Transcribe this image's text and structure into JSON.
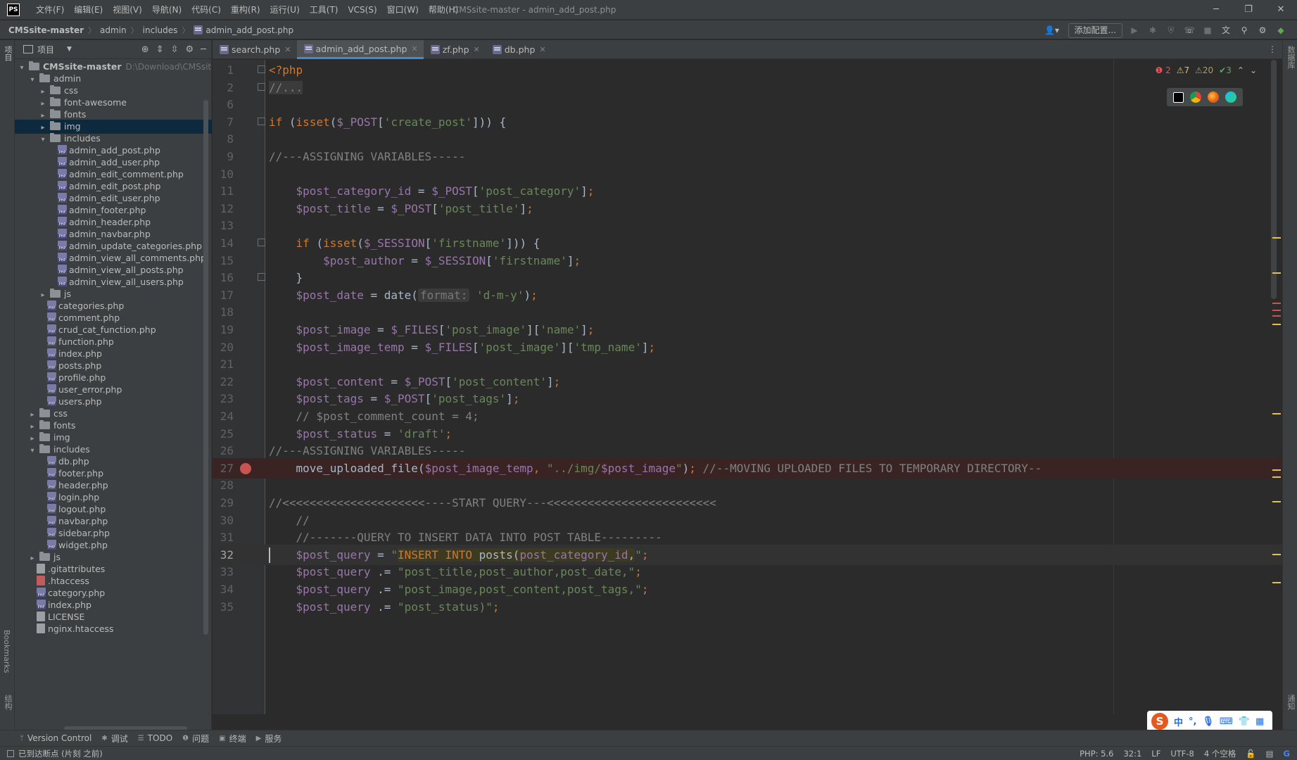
{
  "menu": [
    "文件(F)",
    "编辑(E)",
    "视图(V)",
    "导航(N)",
    "代码(C)",
    "重构(R)",
    "运行(U)",
    "工具(T)",
    "VCS(S)",
    "窗口(W)",
    "帮助(H)"
  ],
  "window_title": "CMSsite-master - admin_add_post.php",
  "app_logo": "PS",
  "breadcrumb": [
    "CMSsite-master",
    "admin",
    "includes",
    "admin_add_post.php"
  ],
  "nav_right": {
    "add_config": "添加配置..."
  },
  "left_strip": {
    "project": "项目",
    "bookmarks": "Bookmarks",
    "structure": "结构"
  },
  "right_strip": {
    "database": "数据库",
    "notifications": "通知"
  },
  "project_panel": {
    "title": "项目"
  },
  "tree": [
    {
      "depth": 0,
      "arrow": "open",
      "icon": "folder",
      "label": "CMSsite-master",
      "bold": true,
      "extra": "D:\\Download\\CMSsite"
    },
    {
      "depth": 1,
      "arrow": "open",
      "icon": "folder",
      "label": "admin"
    },
    {
      "depth": 2,
      "arrow": "closed",
      "icon": "folder",
      "label": "css"
    },
    {
      "depth": 2,
      "arrow": "closed",
      "icon": "folder",
      "label": "font-awesome"
    },
    {
      "depth": 2,
      "arrow": "closed",
      "icon": "folder",
      "label": "fonts"
    },
    {
      "depth": 2,
      "arrow": "closed",
      "icon": "folder",
      "label": "img",
      "selected": true
    },
    {
      "depth": 2,
      "arrow": "open",
      "icon": "folder",
      "label": "includes"
    },
    {
      "depth": 3,
      "icon": "php",
      "label": "admin_add_post.php"
    },
    {
      "depth": 3,
      "icon": "php",
      "label": "admin_add_user.php"
    },
    {
      "depth": 3,
      "icon": "php",
      "label": "admin_edit_comment.php"
    },
    {
      "depth": 3,
      "icon": "php",
      "label": "admin_edit_post.php"
    },
    {
      "depth": 3,
      "icon": "php",
      "label": "admin_edit_user.php"
    },
    {
      "depth": 3,
      "icon": "php",
      "label": "admin_footer.php"
    },
    {
      "depth": 3,
      "icon": "php",
      "label": "admin_header.php"
    },
    {
      "depth": 3,
      "icon": "php",
      "label": "admin_navbar.php"
    },
    {
      "depth": 3,
      "icon": "php",
      "label": "admin_update_categories.php"
    },
    {
      "depth": 3,
      "icon": "php",
      "label": "admin_view_all_comments.php"
    },
    {
      "depth": 3,
      "icon": "php",
      "label": "admin_view_all_posts.php"
    },
    {
      "depth": 3,
      "icon": "php",
      "label": "admin_view_all_users.php"
    },
    {
      "depth": 2,
      "arrow": "closed",
      "icon": "folder",
      "label": "js"
    },
    {
      "depth": 2,
      "icon": "php",
      "label": "categories.php"
    },
    {
      "depth": 2,
      "icon": "php",
      "label": "comment.php"
    },
    {
      "depth": 2,
      "icon": "php",
      "label": "crud_cat_function.php"
    },
    {
      "depth": 2,
      "icon": "php",
      "label": "function.php"
    },
    {
      "depth": 2,
      "icon": "php",
      "label": "index.php"
    },
    {
      "depth": 2,
      "icon": "php",
      "label": "posts.php"
    },
    {
      "depth": 2,
      "icon": "php",
      "label": "profile.php"
    },
    {
      "depth": 2,
      "icon": "php",
      "label": "user_error.php"
    },
    {
      "depth": 2,
      "icon": "php",
      "label": "users.php"
    },
    {
      "depth": 1,
      "arrow": "closed",
      "icon": "folder",
      "label": "css"
    },
    {
      "depth": 1,
      "arrow": "closed",
      "icon": "folder",
      "label": "fonts"
    },
    {
      "depth": 1,
      "arrow": "closed",
      "icon": "folder",
      "label": "img"
    },
    {
      "depth": 1,
      "arrow": "open",
      "icon": "folder",
      "label": "includes"
    },
    {
      "depth": 2,
      "icon": "php",
      "label": "db.php"
    },
    {
      "depth": 2,
      "icon": "php",
      "label": "footer.php"
    },
    {
      "depth": 2,
      "icon": "php",
      "label": "header.php"
    },
    {
      "depth": 2,
      "icon": "php",
      "label": "login.php"
    },
    {
      "depth": 2,
      "icon": "php",
      "label": "logout.php"
    },
    {
      "depth": 2,
      "icon": "php",
      "label": "navbar.php"
    },
    {
      "depth": 2,
      "icon": "php",
      "label": "sidebar.php"
    },
    {
      "depth": 2,
      "icon": "php",
      "label": "widget.php"
    },
    {
      "depth": 1,
      "arrow": "closed",
      "icon": "folder",
      "label": "js"
    },
    {
      "depth": 1,
      "icon": "gitattr",
      "label": ".gitattributes"
    },
    {
      "depth": 1,
      "icon": "htaccess",
      "label": ".htaccess"
    },
    {
      "depth": 1,
      "icon": "php",
      "label": "category.php"
    },
    {
      "depth": 1,
      "icon": "php",
      "label": "index.php"
    },
    {
      "depth": 1,
      "icon": "plain",
      "label": "LICENSE"
    },
    {
      "depth": 1,
      "icon": "plain",
      "label": "nginx.htaccess"
    }
  ],
  "tabs": [
    {
      "label": "search.php",
      "active": false
    },
    {
      "label": "admin_add_post.php",
      "active": true
    },
    {
      "label": "zf.php",
      "active": false
    },
    {
      "label": "db.php",
      "active": false
    }
  ],
  "inspections": {
    "errors": "2",
    "warnings": "7",
    "weak_warnings": "20",
    "ok": "3"
  },
  "code_lines": [
    {
      "n": "1",
      "fold": true,
      "tokens": [
        [
          "kw",
          "<?php"
        ]
      ]
    },
    {
      "n": "2",
      "fold": true,
      "tokens": [
        [
          "folded",
          "//..."
        ]
      ]
    },
    {
      "n": "6",
      "tokens": []
    },
    {
      "n": "7",
      "fold": true,
      "tokens": [
        [
          "kw",
          "if "
        ],
        [
          "p",
          "("
        ],
        [
          "kw",
          "isset"
        ],
        [
          "p",
          "("
        ],
        [
          "var",
          "$_POST"
        ],
        [
          "p",
          "["
        ],
        [
          "str",
          "'create_post'"
        ],
        [
          "p",
          "])) {"
        ]
      ]
    },
    {
      "n": "8",
      "tokens": []
    },
    {
      "n": "9",
      "tokens": [
        [
          "cmt",
          "//---ASSIGNING VARIABLES-----"
        ]
      ]
    },
    {
      "n": "10",
      "tokens": []
    },
    {
      "n": "11",
      "tokens": [
        [
          "p",
          "    "
        ],
        [
          "var",
          "$post_category_id"
        ],
        [
          "p",
          " = "
        ],
        [
          "var",
          "$_POST"
        ],
        [
          "p",
          "["
        ],
        [
          "str",
          "'post_category'"
        ],
        [
          "p",
          "]"
        ],
        [
          "kw",
          ";"
        ]
      ]
    },
    {
      "n": "12",
      "tokens": [
        [
          "p",
          "    "
        ],
        [
          "var",
          "$post_title"
        ],
        [
          "p",
          " = "
        ],
        [
          "var",
          "$_POST"
        ],
        [
          "p",
          "["
        ],
        [
          "str",
          "'post_title'"
        ],
        [
          "p",
          "]"
        ],
        [
          "kw",
          ";"
        ]
      ]
    },
    {
      "n": "13",
      "tokens": []
    },
    {
      "n": "14",
      "fold": true,
      "tokens": [
        [
          "p",
          "    "
        ],
        [
          "kw",
          "if "
        ],
        [
          "p",
          "("
        ],
        [
          "kw",
          "isset"
        ],
        [
          "p",
          "("
        ],
        [
          "var",
          "$_SESSION"
        ],
        [
          "p",
          "["
        ],
        [
          "str",
          "'firstname'"
        ],
        [
          "p",
          "])) {"
        ]
      ]
    },
    {
      "n": "15",
      "tokens": [
        [
          "p",
          "        "
        ],
        [
          "var",
          "$post_author"
        ],
        [
          "p",
          " = "
        ],
        [
          "var",
          "$_SESSION"
        ],
        [
          "p",
          "["
        ],
        [
          "str",
          "'firstname'"
        ],
        [
          "p",
          "]"
        ],
        [
          "kw",
          ";"
        ]
      ]
    },
    {
      "n": "16",
      "fold": true,
      "tokens": [
        [
          "p",
          "    }"
        ]
      ]
    },
    {
      "n": "17",
      "tokens": [
        [
          "p",
          "    "
        ],
        [
          "var",
          "$post_date"
        ],
        [
          "p",
          " = "
        ],
        [
          "p",
          "date("
        ],
        [
          "hint",
          "format:"
        ],
        [
          "p",
          " "
        ],
        [
          "str",
          "'d-m-y'"
        ],
        [
          "p",
          ")"
        ],
        [
          "kw",
          ";"
        ]
      ]
    },
    {
      "n": "18",
      "tokens": []
    },
    {
      "n": "19",
      "tokens": [
        [
          "p",
          "    "
        ],
        [
          "var",
          "$post_image"
        ],
        [
          "p",
          " = "
        ],
        [
          "var",
          "$_FILES"
        ],
        [
          "p",
          "["
        ],
        [
          "str",
          "'post_image'"
        ],
        [
          "p",
          "]["
        ],
        [
          "str",
          "'name'"
        ],
        [
          "p",
          "]"
        ],
        [
          "kw",
          ";"
        ]
      ]
    },
    {
      "n": "20",
      "tokens": [
        [
          "p",
          "    "
        ],
        [
          "var",
          "$post_image_temp"
        ],
        [
          "p",
          " = "
        ],
        [
          "var",
          "$_FILES"
        ],
        [
          "p",
          "["
        ],
        [
          "str",
          "'post_image'"
        ],
        [
          "p",
          "]["
        ],
        [
          "str",
          "'tmp_name'"
        ],
        [
          "p",
          "]"
        ],
        [
          "kw",
          ";"
        ]
      ]
    },
    {
      "n": "21",
      "tokens": []
    },
    {
      "n": "22",
      "tokens": [
        [
          "p",
          "    "
        ],
        [
          "var",
          "$post_content"
        ],
        [
          "p",
          " = "
        ],
        [
          "var",
          "$_POST"
        ],
        [
          "p",
          "["
        ],
        [
          "str",
          "'post_content'"
        ],
        [
          "p",
          "]"
        ],
        [
          "kw",
          ";"
        ]
      ]
    },
    {
      "n": "23",
      "tokens": [
        [
          "p",
          "    "
        ],
        [
          "var",
          "$post_tags"
        ],
        [
          "p",
          " = "
        ],
        [
          "var",
          "$_POST"
        ],
        [
          "p",
          "["
        ],
        [
          "str",
          "'post_tags'"
        ],
        [
          "p",
          "]"
        ],
        [
          "kw",
          ";"
        ]
      ]
    },
    {
      "n": "24",
      "tokens": [
        [
          "cmt",
          "    // $post_comment_count = 4;"
        ]
      ]
    },
    {
      "n": "25",
      "tokens": [
        [
          "p",
          "    "
        ],
        [
          "var",
          "$post_status"
        ],
        [
          "p",
          " = "
        ],
        [
          "str",
          "'draft'"
        ],
        [
          "kw",
          ";"
        ]
      ]
    },
    {
      "n": "26",
      "tokens": [
        [
          "cmt",
          "//---ASSIGNING VARIABLES-----"
        ]
      ]
    },
    {
      "n": "27",
      "bp": true,
      "tokens": [
        [
          "p",
          "    move_uploaded_file("
        ],
        [
          "var",
          "$post_image_temp"
        ],
        [
          "kw",
          ", "
        ],
        [
          "str",
          "\"../img/"
        ],
        [
          "var",
          "$post_image"
        ],
        [
          "str",
          "\""
        ],
        [
          "p",
          ")"
        ],
        [
          "kw",
          ";"
        ],
        [
          "p",
          " "
        ],
        [
          "cmt",
          "//--MOVING UPLOADED FILES TO TEMPORARY DIRECTORY--"
        ]
      ]
    },
    {
      "n": "28",
      "tokens": []
    },
    {
      "n": "29",
      "tokens": [
        [
          "cmt",
          "//<<<<<<<<<<<<<<<<<<<<<----START QUERY---<<<<<<<<<<<<<<<<<<<<<<<<<"
        ]
      ]
    },
    {
      "n": "30",
      "tokens": [
        [
          "cmt",
          "    //"
        ]
      ]
    },
    {
      "n": "31",
      "tokens": [
        [
          "cmt",
          "    //-------QUERY TO INSERT DATA INTO POST TABLE---------"
        ]
      ]
    },
    {
      "n": "32",
      "cur": true,
      "tokens": [
        [
          "p",
          "    "
        ],
        [
          "var",
          "$post_query"
        ],
        [
          "p",
          " = "
        ],
        [
          "str",
          "\""
        ],
        [
          "sqlhl",
          "INSERT INTO "
        ],
        [
          "sqlfn",
          "posts("
        ],
        [
          "sqlcol",
          "post_category_id"
        ],
        [
          "sqlfn",
          ","
        ],
        [
          "str",
          "\""
        ],
        [
          "kw",
          ";"
        ]
      ]
    },
    {
      "n": "33",
      "tokens": [
        [
          "p",
          "    "
        ],
        [
          "var",
          "$post_query"
        ],
        [
          "p",
          " .= "
        ],
        [
          "str",
          "\"post_title,post_author,post_date,\""
        ],
        [
          "kw",
          ";"
        ]
      ]
    },
    {
      "n": "34",
      "tokens": [
        [
          "p",
          "    "
        ],
        [
          "var",
          "$post_query"
        ],
        [
          "p",
          " .= "
        ],
        [
          "str",
          "\"post_image,post_content,post_tags,\""
        ],
        [
          "kw",
          ";"
        ]
      ]
    },
    {
      "n": "35",
      "tokens": [
        [
          "p",
          "    "
        ],
        [
          "var",
          "$post_query"
        ],
        [
          "p",
          " .= "
        ],
        [
          "str",
          "\"post_status)\""
        ],
        [
          "kw",
          ";"
        ]
      ]
    }
  ],
  "bottom_tools": [
    {
      "icon": "vcs-icon",
      "glyph": "ᛘ",
      "label": "Version Control"
    },
    {
      "icon": "debug-icon",
      "glyph": "✱",
      "label": "调试"
    },
    {
      "icon": "todo-icon",
      "glyph": "☰",
      "label": "TODO"
    },
    {
      "icon": "problems-icon",
      "glyph": "❶",
      "label": "问题"
    },
    {
      "icon": "terminal-icon",
      "glyph": "▣",
      "label": "终端"
    },
    {
      "icon": "services-icon",
      "glyph": "▶",
      "label": "服务"
    }
  ],
  "status": {
    "message": "已到达断点 (片刻 之前)",
    "php": "PHP: 5.6",
    "position": "32:1",
    "line_sep": "LF",
    "encoding": "UTF-8",
    "indent": "4 个空格"
  },
  "ime": {
    "lang": "中",
    "punct": "°,",
    "logo": "S"
  }
}
